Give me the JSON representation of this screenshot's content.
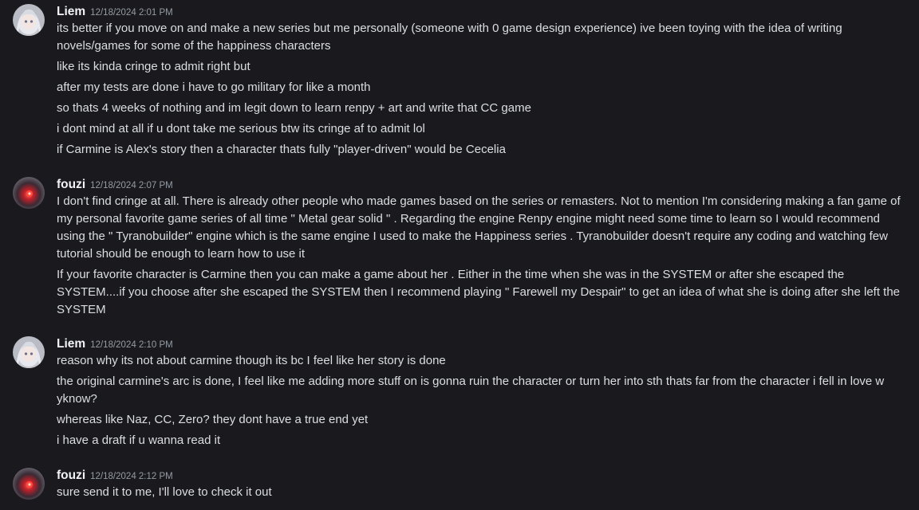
{
  "colors": {
    "background": "#1a1a1e",
    "text": "#dbdee1",
    "username": "#f2f3f5",
    "timestamp": "#949ba4"
  },
  "messages": [
    {
      "author": "Liem",
      "timestamp": "12/18/2024 2:01 PM",
      "avatar_icon": "anime-girl-avatar",
      "lines": [
        "its better if you move on and make a new series but me personally (someone with 0 game design experience) ive been toying with the idea of writing novels/games for some of the happiness characters",
        "like its kinda cringe to admit right but",
        "after my tests are done i have to go military for like a month",
        "so thats 4 weeks of nothing and im legit down to learn renpy + art and write that CC game",
        "i dont mind at all if u dont take me serious btw its cringe af to admit lol",
        "if Carmine is Alex's story then a character thats fully \"player-driven\" would be Cecelia"
      ]
    },
    {
      "author": "fouzi",
      "timestamp": "12/18/2024 2:07 PM",
      "avatar_icon": "red-glow-avatar",
      "lines": [
        "I don't find cringe at all. There is already other people who made games based on the series or remasters. Not to mention I'm considering making a fan game of my personal favorite game series of all time \" Metal gear solid \" . Regarding the engine Renpy engine might need some time to learn so I would recommend using the \" Tyranobuilder\" engine which is the same engine I used to make the Happiness series . Tyranobuilder doesn't require any coding and watching few tutorial should be enough to learn how to use it",
        "If your favorite character is Carmine then you can make a game about her . Either in the time when she was in the SYSTEM or after she escaped the SYSTEM....if you choose after she escaped the SYSTEM then I recommend playing \" Farewell my Despair\" to get an idea of what she is doing after she left the SYSTEM"
      ]
    },
    {
      "author": "Liem",
      "timestamp": "12/18/2024 2:10 PM",
      "avatar_icon": "anime-girl-avatar",
      "lines": [
        "reason why its not about carmine though its bc I feel like her story is done",
        "the original carmine's arc is done, I feel like me adding more stuff on is gonna ruin the character or turn her into sth thats far from the character i fell in love w yknow?",
        "whereas like Naz, CC, Zero? they dont have a true end yet",
        "i have a draft if u wanna read it"
      ]
    },
    {
      "author": "fouzi",
      "timestamp": "12/18/2024 2:12 PM",
      "avatar_icon": "red-glow-avatar",
      "lines": [
        "sure send it to me, I'll love to check it out"
      ]
    }
  ]
}
